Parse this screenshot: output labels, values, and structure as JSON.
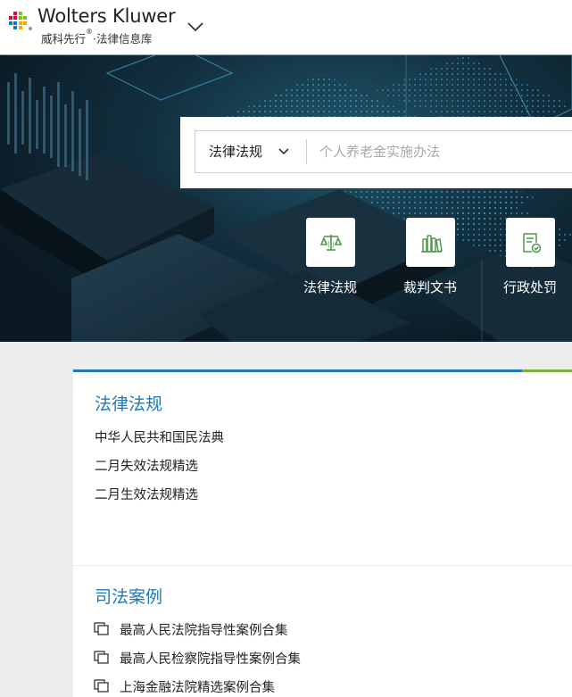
{
  "header": {
    "brand": "Wolters Kluwer",
    "subtitle": "威科先行",
    "subtitle_mark": "®",
    "subtitle_rest": "·法律信息库"
  },
  "search": {
    "type_label": "法律法规",
    "placeholder": "个人养老金实施办法"
  },
  "quick_links": [
    {
      "label": "法律法规",
      "icon": "scales-icon"
    },
    {
      "label": "裁判文书",
      "icon": "books-icon"
    },
    {
      "label": "行政处罚",
      "icon": "document-badge-icon"
    }
  ],
  "laws": {
    "title": "法律法规",
    "items": [
      "中华人民共和国民法典",
      "二月失效法规精选",
      "二月生效法规精选"
    ]
  },
  "cases": {
    "title": "司法案例",
    "items": [
      "最高人民法院指导性案例合集",
      "最高人民检察院指导性案例合集",
      "上海金融法院精选案例合集"
    ]
  },
  "colors": {
    "accent_blue": "#1f79b9",
    "accent_green": "#7fae3a",
    "icon_green": "#4f9a4a"
  }
}
